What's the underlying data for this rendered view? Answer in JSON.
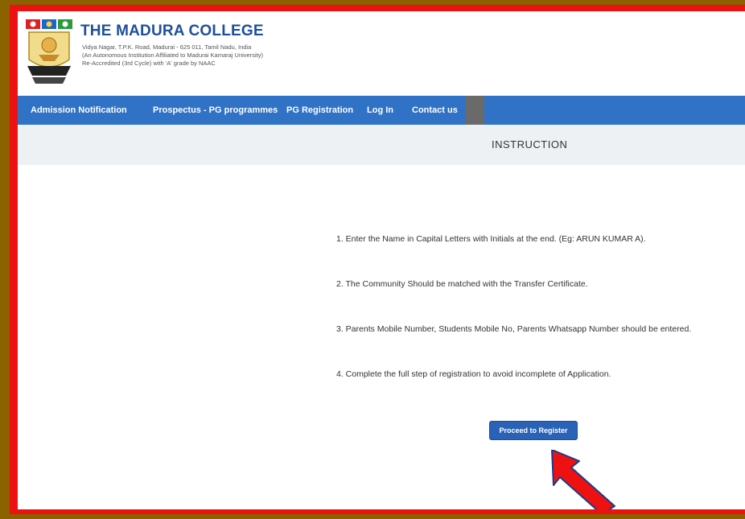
{
  "header": {
    "college_name": "THE MADURA COLLEGE",
    "address_line1": "Vidya Nagar, T.P.K. Road, Madurai - 625 011, Tamil Nadu, India",
    "address_line2": "(An Autonomous Institution Affiliated to Madurai Kamaraj University)",
    "address_line3": "Re-Accredited (3rd Cycle) with 'A' grade by NAAC"
  },
  "nav": {
    "items": [
      {
        "label": "Admission Notification"
      },
      {
        "label": "Prospectus - PG programmes"
      },
      {
        "label": "PG Registration"
      },
      {
        "label": "Log In"
      },
      {
        "label": "Contact us"
      }
    ]
  },
  "main": {
    "title": "INSTRUCTION",
    "instructions": [
      "1. Enter the Name in Capital Letters with Initials at the end. (Eg: ARUN KUMAR A).",
      "2. The Community Should be matched with the Transfer Certificate.",
      "3. Parents Mobile Number, Students Mobile No, Parents Whatsapp Number should be entered.",
      "4. Complete the full step of registration to avoid incomplete of Application."
    ],
    "proceed_label": "Proceed to Register"
  },
  "colors": {
    "brand_blue": "#1f4f9c",
    "nav_bg": "#2f72c6",
    "button_bg": "#2a62b8",
    "frame_red": "#ee1111",
    "frame_outer": "#8a6200"
  },
  "icons": {
    "logo": "college-emblem-icon",
    "arrow": "red-pointer-arrow-icon"
  }
}
